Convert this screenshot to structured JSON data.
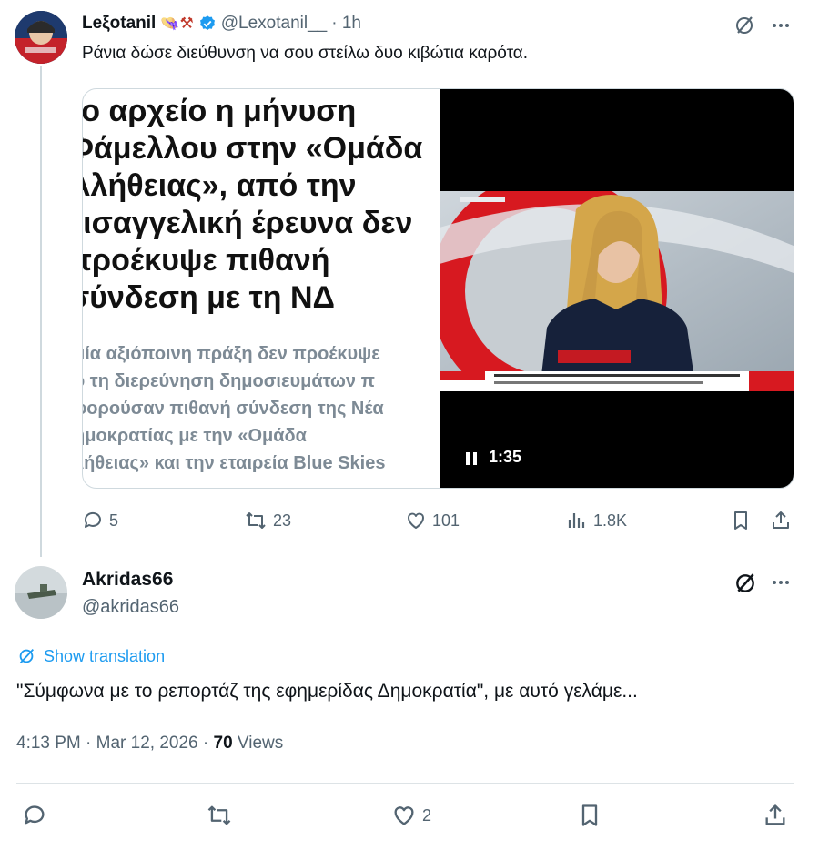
{
  "tweet1": {
    "author_name": "Leξotanil",
    "author_emojis": "👒⚒",
    "handle": "@Lexotanil__",
    "time": "· 1h",
    "text": "Ράνια δώσε διεύθυνση να σου στείλω δυο κιβώτια καρότα.",
    "media": {
      "headline_lines": [
        "το αρχείο η μήνυση",
        "Φάμελλου στην «Ομάδα",
        "Αλήθειας», από την",
        "εισαγγελική έρευνα δεν",
        "προέκυψε πιθανή",
        "σύνδεση με τη ΝΔ"
      ],
      "body_lines": [
        "μία αξιόποινη πράξη δεν προέκυψε",
        "ό τη διερεύνηση δημοσιευμάτων π",
        "φορούσαν πιθανή σύνδεση της Νέα",
        "ημοκρατίας με την «Ομάδα",
        "λήθειας» και την εταιρεία Blue Skies"
      ],
      "video_duration": "1:35"
    },
    "stats": {
      "replies": "5",
      "reposts": "23",
      "likes": "101",
      "views": "1.8K"
    }
  },
  "tweet2": {
    "author_name": "Akridas66",
    "handle": "@akridas66",
    "show_translation": "Show translation",
    "text": "\"Σύμφωνα με το ρεπορτάζ της εφημερίδας Δημοκρατία\", με αυτό γελάμε...",
    "timestamp": "4:13 PM · Mar 12, 2026 · ",
    "views_count": "70",
    "views_label": " Views",
    "likes": "2"
  },
  "colors": {
    "accent": "#1d9bf0",
    "muted": "#536471",
    "text": "#0f1419",
    "news_red": "#d71920"
  }
}
